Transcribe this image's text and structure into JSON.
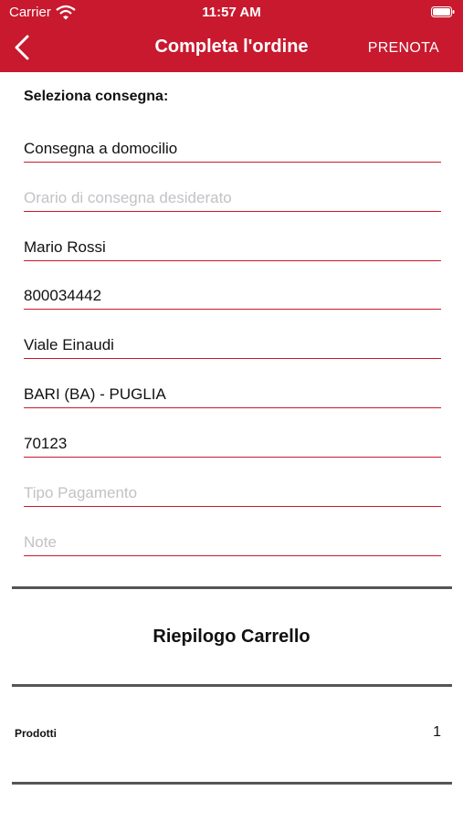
{
  "status": {
    "carrier": "Carrier",
    "time": "11:57 AM"
  },
  "nav": {
    "back_icon": "chevron-left-icon",
    "title": "Completa l'ordine",
    "action": "PRENOTA"
  },
  "form": {
    "section_label": "Seleziona consegna:",
    "delivery_type": "Consegna a domocilio",
    "delivery_time_placeholder": "Orario di consegna desiderato",
    "name": "Mario Rossi",
    "phone": "800034442",
    "address": "Viale Einaudi",
    "city": "BARI (BA) - PUGLIA",
    "postal_code": "70123",
    "payment_placeholder": "Tipo Pagamento",
    "notes_placeholder": "Note"
  },
  "summary": {
    "title": "Riepilogo Carrello",
    "products_label": "Prodotti",
    "products_count": "1"
  },
  "colors": {
    "accent": "#C8192E",
    "placeholder": "#C2C2C7",
    "divider": "#555555"
  }
}
